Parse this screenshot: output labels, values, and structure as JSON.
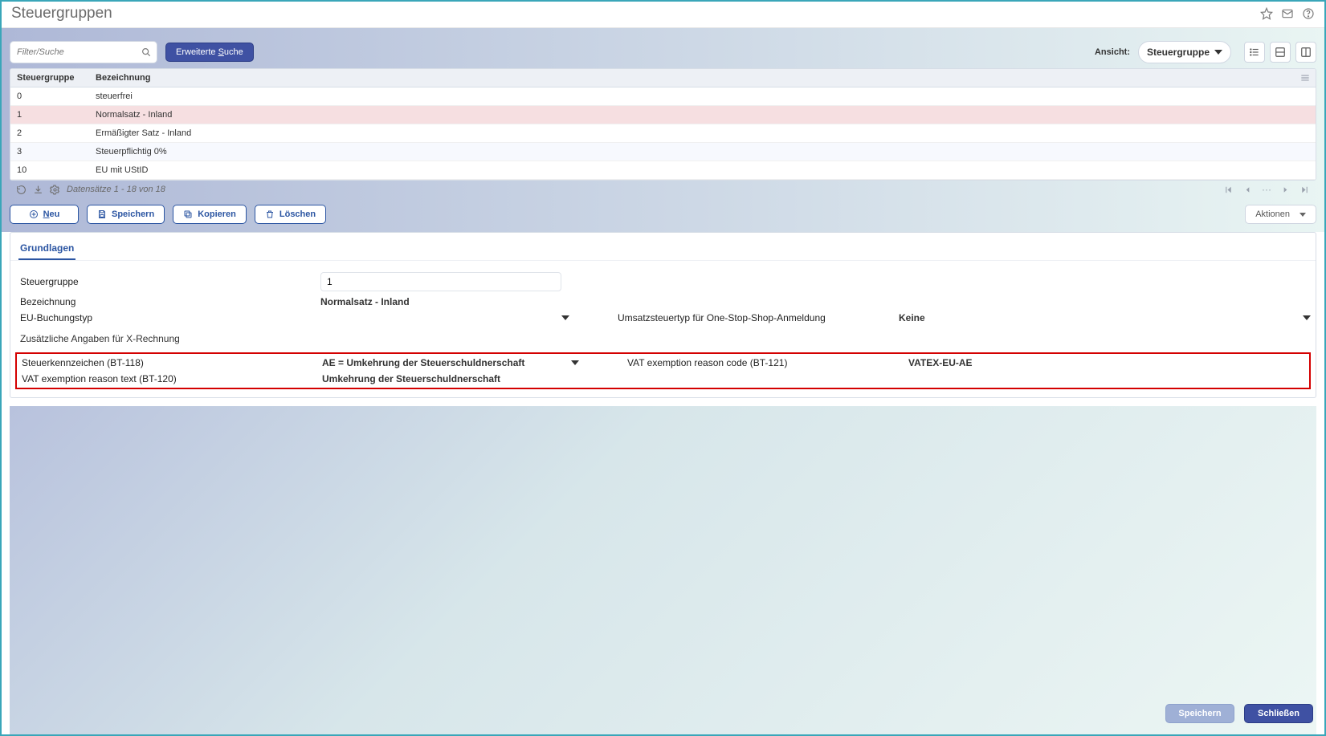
{
  "header": {
    "title": "Steuergruppen"
  },
  "toolbar": {
    "search_placeholder": "Filter/Suche",
    "adv_search": "Erweiterte Suche",
    "ansicht_label": "Ansicht:",
    "ansicht_value": "Steuergruppe"
  },
  "grid": {
    "col_a": "Steuergruppe",
    "col_b": "Bezeichnung",
    "rows": [
      {
        "a": "0",
        "b": "steuerfrei",
        "sel": false
      },
      {
        "a": "1",
        "b": "Normalsatz - Inland",
        "sel": true
      },
      {
        "a": "2",
        "b": "Ermäßigter Satz - Inland",
        "sel": false
      },
      {
        "a": "3",
        "b": "Steuerpflichtig 0%",
        "sel": false
      },
      {
        "a": "10",
        "b": "EU mit UStID",
        "sel": false
      }
    ],
    "footer": "Datensätze 1 - 18 von 18"
  },
  "actions": {
    "neu": "Neu",
    "speichern": "Speichern",
    "kopieren": "Kopieren",
    "loeschen": "Löschen",
    "aktionen": "Aktionen"
  },
  "tabs": {
    "grundlagen": "Grundlagen"
  },
  "form": {
    "steuergruppe_l": "Steuergruppe",
    "steuergruppe_v": "1",
    "bezeichnung_l": "Bezeichnung",
    "bezeichnung_v": "Normalsatz - Inland",
    "eubuchungstyp_l": "EU-Buchungstyp",
    "eubuchungstyp_v": "",
    "umsatzsteuertyp_l": "Umsatzsteuertyp für One-Stop-Shop-Anmeldung",
    "umsatzsteuertyp_v": "Keine",
    "xrechnung_section": "Zusätzliche Angaben für X-Rechnung",
    "bt118_l": "Steuerkennzeichen (BT-118)",
    "bt118_v": "AE = Umkehrung der Steuerschuldnerschaft",
    "bt121_l": "VAT exemption reason code (BT-121)",
    "bt121_v": "VATEX-EU-AE",
    "bt120_l": "VAT exemption reason text (BT-120)",
    "bt120_v": "Umkehrung der Steuerschuldnerschaft"
  },
  "footer": {
    "save": "Speichern",
    "close": "Schließen"
  },
  "paging": {
    "dots": "···"
  }
}
